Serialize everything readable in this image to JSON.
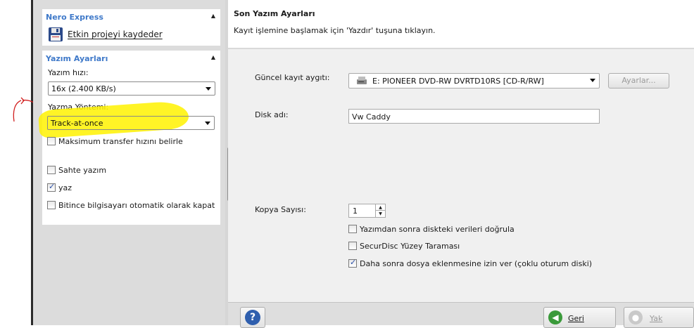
{
  "left_panel": {
    "nero_express": {
      "title": "Nero Express",
      "save_project_label": "Etkin projeyi kaydeder"
    },
    "burn_settings": {
      "title": "Yazım Ayarları",
      "speed_label": "Yazım hızı:",
      "speed_value": "16x (2.400 KB/s)",
      "method_label": "Yazma Yöntemi:",
      "method_value": "Track-at-once",
      "max_transfer_label": "Maksimum transfer hızını belirle",
      "simulate_label": "Sahte yazım",
      "write_label": "yaz",
      "shutdown_label": "Bitince bilgisayarı otomatik olarak kapat",
      "max_transfer_checked": false,
      "simulate_checked": false,
      "write_checked": true,
      "shutdown_checked": false
    }
  },
  "main": {
    "title": "Son Yazım Ayarları",
    "subtitle": "Kayıt işlemine başlamak için 'Yazdır' tuşuna tıklayın.",
    "recorder_label": "Güncel kayıt aygıtı:",
    "recorder_value": "E: PIONEER DVD-RW DVRTD10RS   [CD-R/RW]",
    "settings_button": "Ayarlar...",
    "disc_name_label": "Disk adı:",
    "disc_name_value": "Vw Caddy",
    "copies_label": "Kopya Sayısı:",
    "copies_value": "1",
    "verify_label": "Yazımdan sonra diskteki verileri doğrula",
    "securdisc_label": "SecurDisc Yüzey Taraması",
    "multisession_label": "Daha sonra dosya eklenmesine izin ver (çoklu oturum diski)",
    "verify_checked": false,
    "securdisc_checked": false,
    "multisession_checked": true
  },
  "bottom": {
    "help_icon": "?",
    "back_label": "Geri",
    "burn_label": "Yak"
  },
  "colors": {
    "panel_title": "#3f79c9",
    "highlight": "#fff200",
    "annotation_red": "#d11f1f"
  }
}
